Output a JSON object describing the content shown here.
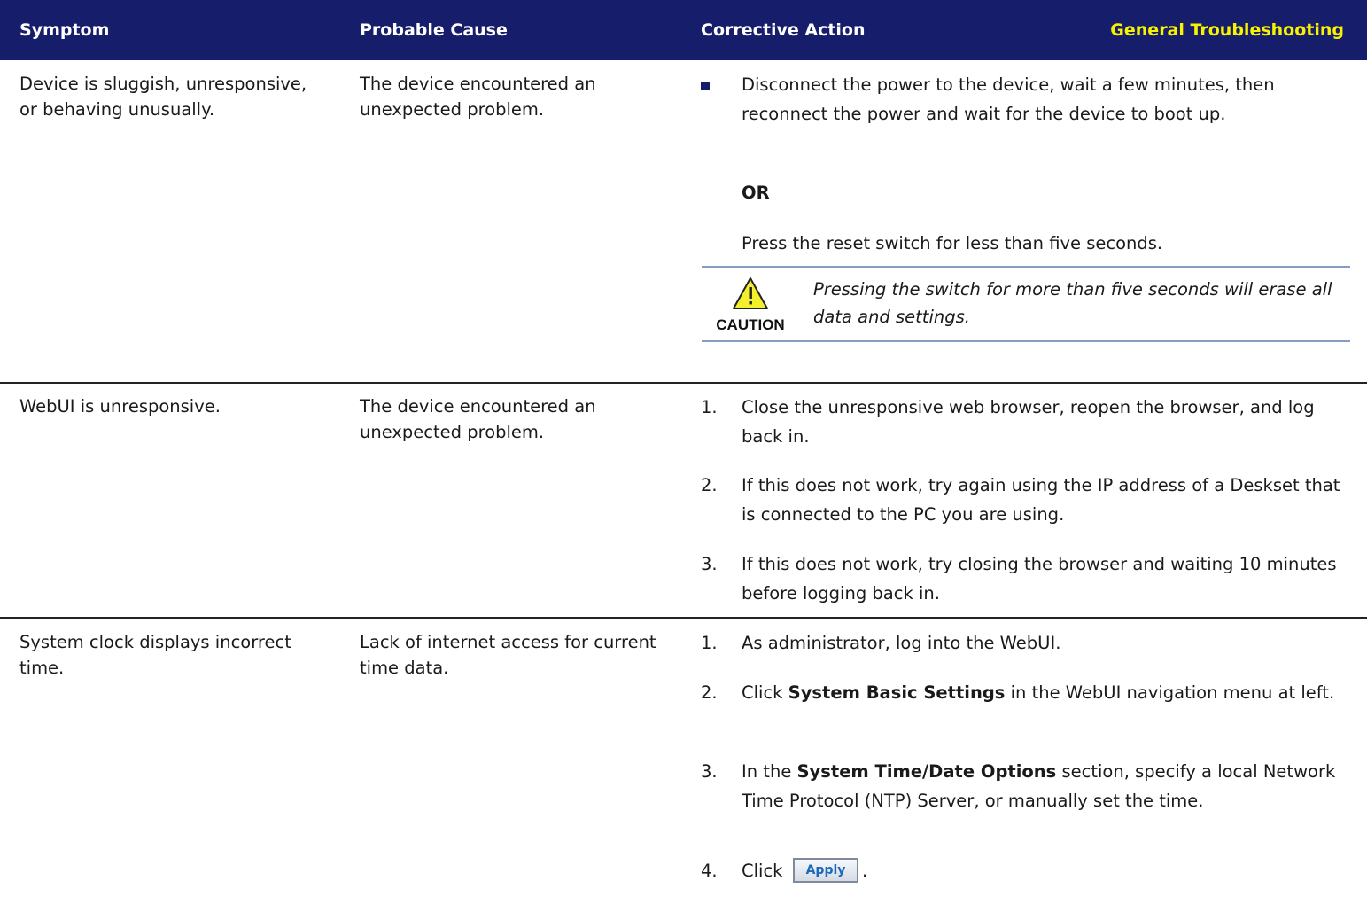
{
  "header": {
    "symptom": "Symptom",
    "probable_cause": "Probable Cause",
    "corrective_action": "Corrective Action",
    "section_title": "General Troubleshooting",
    "bar_color": "#161d6b",
    "section_color": "#f7f200"
  },
  "rows": [
    {
      "symptom": "Device is sluggish, unresponsive, or behaving unusually.",
      "cause": "The device encountered an unexpected problem.",
      "actions": [
        {
          "marker": "bullet",
          "text": "Disconnect the power to the device, wait a few minutes, then reconnect the power and wait for the device to boot up."
        },
        {
          "text": "OR"
        },
        {
          "text": "Press the reset switch for less than five seconds."
        }
      ],
      "caution": {
        "icon": "caution-triangle-icon",
        "label": "CAUTION",
        "text": "Pressing the switch for more than five seconds will erase all data and settings."
      }
    },
    {
      "symptom": "WebUI is unresponsive.",
      "cause": "The device encountered an unexpected problem.",
      "actions": [
        {
          "marker": "1.",
          "text": "Close the unresponsive web browser, reopen the browser, and log back in."
        },
        {
          "marker": "2.",
          "text": "If this does not work, try again using the IP address of a Deskset that is connected to the PC you are using."
        },
        {
          "marker": "3.",
          "text": "If this does not work, try closing the browser and waiting 10 minutes before logging back in."
        }
      ]
    },
    {
      "symptom": "System clock displays incorrect time.",
      "cause": "Lack of internet access for current time data.",
      "actions": [
        {
          "marker": "1.",
          "text": "As administrator, log into the WebUI."
        },
        {
          "marker": "2.",
          "pre": "Click ",
          "bold": "System Basic Settings",
          "post": " in the WebUI navigation menu at left."
        },
        {
          "marker": "3.",
          "pre": "In the ",
          "bold": "System Time/Date Options",
          "post": " section, specify a local Network Time Protocol (NTP) Server, or manually set the time."
        },
        {
          "marker": "4.",
          "pre": "Click ",
          "button": "Apply",
          "post": "."
        }
      ]
    }
  ]
}
